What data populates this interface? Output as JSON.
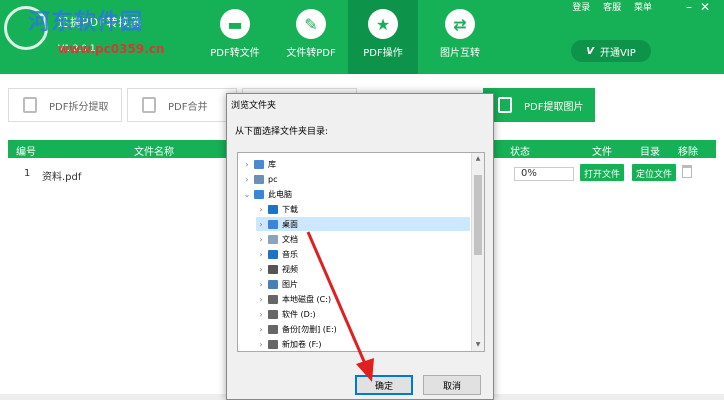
{
  "app": {
    "title": "迅捷PDF转换器",
    "version": "V1.2.0.1",
    "watermark": "河东软件园",
    "watermark_url": "www.pc0359.cn"
  },
  "nav": [
    {
      "label": "PDF转文件",
      "icon": "folder-icon"
    },
    {
      "label": "文件转PDF",
      "icon": "pdf-icon"
    },
    {
      "label": "PDF操作",
      "icon": "star-icon",
      "active": true
    },
    {
      "label": "图片互转",
      "icon": "convert-icon"
    }
  ],
  "top_links": {
    "login": "登录",
    "service": "客服",
    "menu": "菜单"
  },
  "vip": {
    "label": "开通VIP",
    "icon_text": "V"
  },
  "subtabs": [
    {
      "label": "PDF拆分提取"
    },
    {
      "label": "PDF合并"
    },
    {
      "label": "PDF提取图片",
      "active": true
    }
  ],
  "table": {
    "headers": {
      "index": "编号",
      "name": "文件名称",
      "status": "状态",
      "file": "文件",
      "dir": "目录",
      "remove": "移除"
    },
    "rows": [
      {
        "index": "1",
        "name": "资料.pdf",
        "progress": "0%",
        "open_btn": "打开文件",
        "locate_btn": "定位文件"
      }
    ]
  },
  "dialog": {
    "title": "浏览文件夹",
    "prompt": "从下面选择文件夹目录:",
    "tree": [
      {
        "label": "库",
        "level": 1,
        "arrow": ">",
        "icon": "library-icon",
        "color": "#4a8ad4"
      },
      {
        "label": "pc",
        "level": 1,
        "arrow": ">",
        "icon": "user-icon",
        "color": "#6b8fb5"
      },
      {
        "label": "此电脑",
        "level": 1,
        "arrow": "v",
        "icon": "computer-icon",
        "color": "#3b86d9"
      },
      {
        "label": "下载",
        "level": 2,
        "arrow": ">",
        "icon": "download-icon",
        "color": "#1e73c8"
      },
      {
        "label": "桌面",
        "level": 2,
        "arrow": ">",
        "icon": "desktop-icon",
        "color": "#3b86d9",
        "selected": true
      },
      {
        "label": "文档",
        "level": 2,
        "arrow": ">",
        "icon": "document-icon",
        "color": "#8aa3bf"
      },
      {
        "label": "音乐",
        "level": 2,
        "arrow": ">",
        "icon": "music-icon",
        "color": "#1e73c8"
      },
      {
        "label": "视频",
        "level": 2,
        "arrow": ">",
        "icon": "video-icon",
        "color": "#555555"
      },
      {
        "label": "图片",
        "level": 2,
        "arrow": ">",
        "icon": "picture-icon",
        "color": "#4a7fb5"
      },
      {
        "label": "本地磁盘 (C:)",
        "level": 2,
        "arrow": ">",
        "icon": "drive-icon",
        "color": "#666666"
      },
      {
        "label": "软件 (D:)",
        "level": 2,
        "arrow": ">",
        "icon": "drive-icon",
        "color": "#666666"
      },
      {
        "label": "备份[勿删] (E:)",
        "level": 2,
        "arrow": ">",
        "icon": "drive-icon",
        "color": "#666666"
      },
      {
        "label": "新加卷 (F:)",
        "level": 2,
        "arrow": ">",
        "icon": "drive-icon",
        "color": "#666666"
      }
    ],
    "ok_label": "确定",
    "cancel_label": "取消"
  },
  "colors": {
    "accent": "#16b056",
    "accent_dark": "#0e944a",
    "arrow_red": "#e02020"
  }
}
